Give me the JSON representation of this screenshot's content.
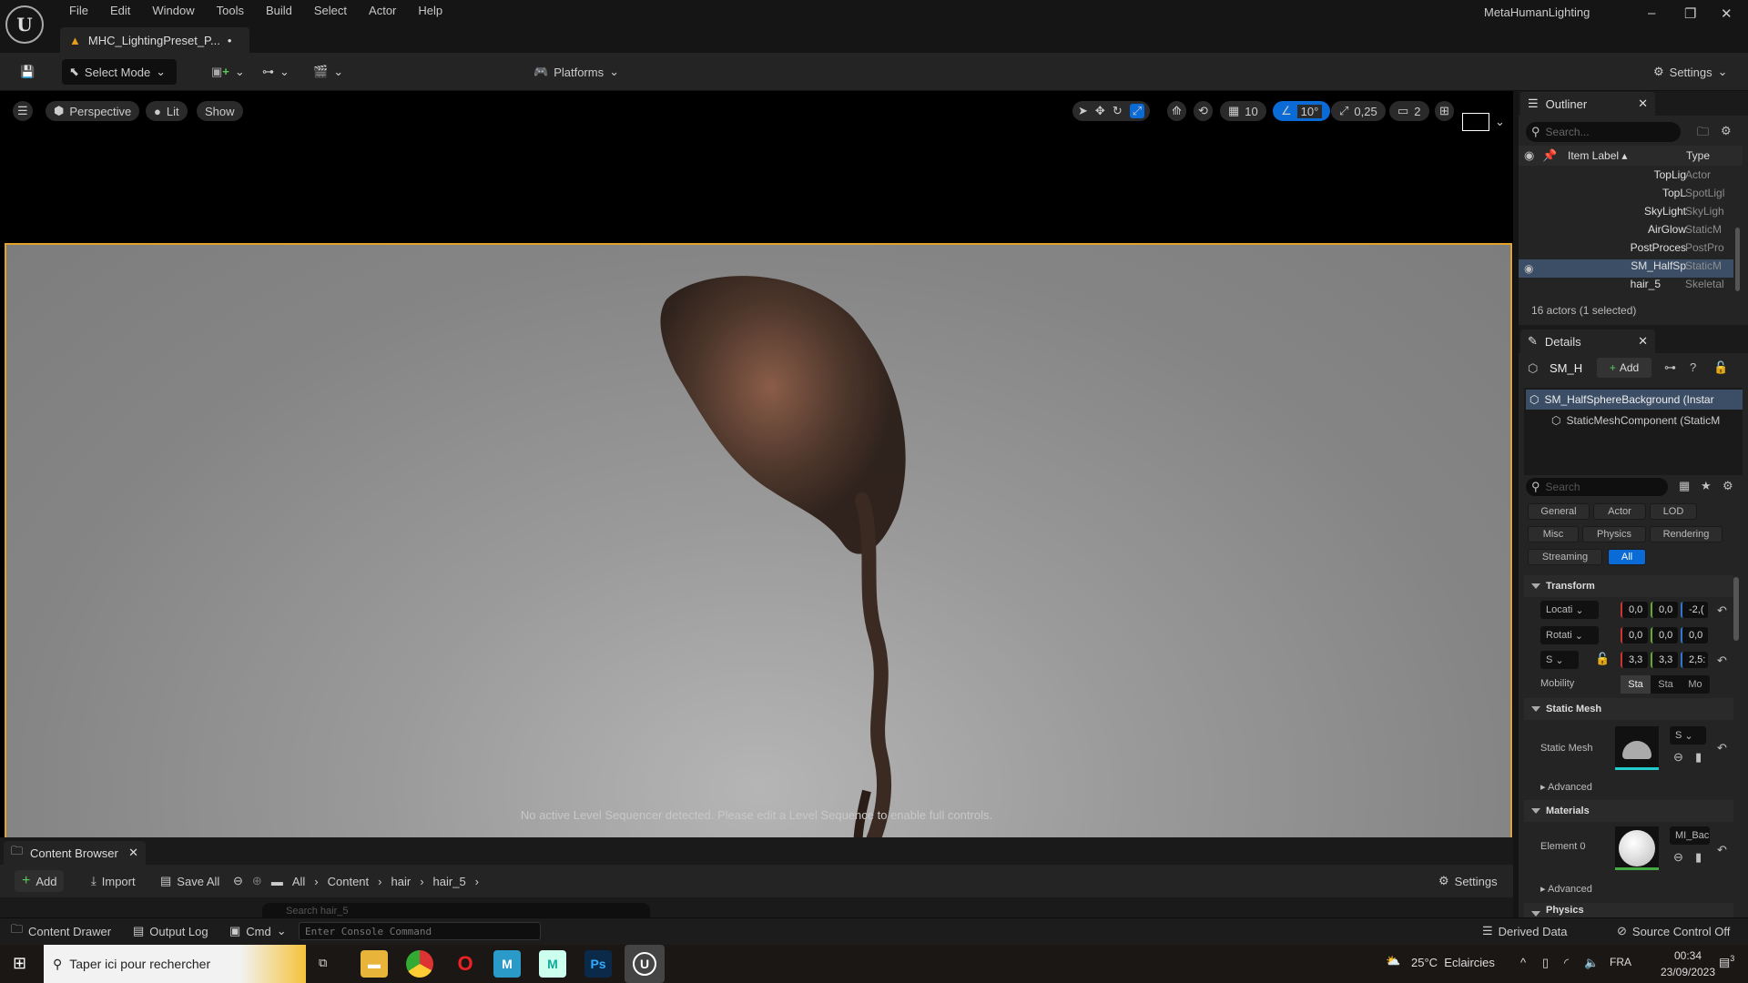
{
  "app": {
    "title": "MetaHumanLighting",
    "doc_tab": "MHC_LightingPreset_P...",
    "dirty_marker": "•"
  },
  "menu": [
    "File",
    "Edit",
    "Window",
    "Tools",
    "Build",
    "Select",
    "Actor",
    "Help"
  ],
  "toolbar": {
    "select_mode": "Select Mode",
    "platforms": "Platforms",
    "settings": "Settings"
  },
  "viewport": {
    "perspective": "Perspective",
    "lit": "Lit",
    "show": "Show",
    "grid_snap": "10",
    "rot_snap": "10°",
    "scale_snap": "0,25",
    "camera_speed": "2",
    "sequencer_message": "No active Level Sequencer detected. Please edit a Level Sequence to enable full controls."
  },
  "outliner": {
    "title": "Outliner",
    "search_placeholder": "Search...",
    "col_label": "Item Label",
    "col_type": "Type",
    "footer": "16 actors (1 selected)",
    "rows": [
      {
        "label": "TopLig",
        "type": "Actor"
      },
      {
        "label": "TopL",
        "type": "SpotLigl"
      },
      {
        "label": "SkyLight",
        "type": "SkyLigh"
      },
      {
        "label": "AirGlow",
        "type": "StaticM"
      },
      {
        "label": "PostProces",
        "type": "PostPro"
      },
      {
        "label": "SM_HalfSp",
        "type": "StaticM"
      },
      {
        "label": "hair_5",
        "type": "Skeletal"
      }
    ]
  },
  "details": {
    "title": "Details",
    "actor_short": "SM_H",
    "add": "Add",
    "component_root": "SM_HalfSphereBackground (Instar",
    "component_child": "StaticMeshComponent (StaticM",
    "search_placeholder": "Search",
    "filters": [
      "General",
      "Actor",
      "LOD",
      "Misc",
      "Physics",
      "Rendering",
      "Streaming",
      "All"
    ],
    "transform": {
      "title": "Transform",
      "location_label": "Locati",
      "rotation_label": "Rotati",
      "scale_label": "S",
      "location": [
        "0,0",
        "0,0",
        "-2,("
      ],
      "rotation": [
        "0,0",
        "0,0",
        "0,0"
      ],
      "scale": [
        "3,3",
        "3,3",
        "2,5:"
      ],
      "mobility_label": "Mobility",
      "mobility": [
        "Sta",
        "Sta",
        "Mo"
      ]
    },
    "static_mesh": {
      "title": "Static Mesh",
      "label": "Static Mesh",
      "value": "S",
      "advanced": "Advanced"
    },
    "materials": {
      "title": "Materials",
      "element_label": "Element 0",
      "value": "MI_Bac",
      "advanced": "Advanced"
    },
    "physics_title": "Physics"
  },
  "content_browser": {
    "title": "Content Browser",
    "add": "Add",
    "import": "Import",
    "save_all": "Save All",
    "breadcrumb": [
      "All",
      "Content",
      "hair",
      "hair_5"
    ],
    "settings": "Settings",
    "search_placeholder": "Search hair_5"
  },
  "statusbar": {
    "content_drawer": "Content Drawer",
    "output_log": "Output Log",
    "cmd": "Cmd",
    "console_placeholder": "Enter Console Command",
    "derived_data": "Derived Data",
    "source_control": "Source Control Off"
  },
  "taskbar": {
    "search_placeholder": "Taper ici pour rechercher",
    "weather": "25°C  Eclaircies",
    "lang": "FRA",
    "time": "00:34",
    "date": "23/09/2023",
    "notifications": "3"
  },
  "colors": {
    "selection_border": "#e3a22a",
    "accent": "#0a6ad6",
    "play": "#56b33a"
  }
}
